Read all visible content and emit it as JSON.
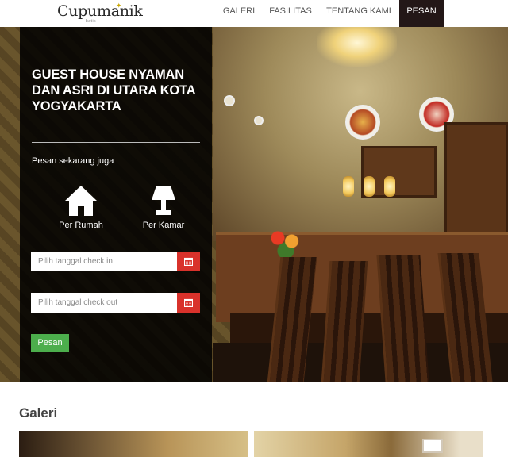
{
  "brand": {
    "name": "Cupumanik",
    "sub": "batik"
  },
  "nav": {
    "items": [
      {
        "label": "GALERI"
      },
      {
        "label": "FASILITAS"
      },
      {
        "label": "TENTANG KAMI"
      },
      {
        "label": "PESAN",
        "active": true
      }
    ]
  },
  "hero": {
    "title": "GUEST HOUSE NYAMAN DAN ASRI DI UTARA KOTA YOGYAKARTA",
    "booking_label": "Pesan sekarang juga",
    "options": [
      {
        "label": "Per Rumah",
        "icon": "house-icon"
      },
      {
        "label": "Per Kamar",
        "icon": "lamp-icon"
      }
    ],
    "checkin": {
      "placeholder": "Pilih tanggal check in",
      "value": ""
    },
    "checkout": {
      "placeholder": "Pilih tanggal check out",
      "value": ""
    },
    "submit_label": "Pesan"
  },
  "gallery": {
    "title": "Galeri"
  },
  "colors": {
    "nav_active_bg": "#231717",
    "calendar_button": "#d9322b",
    "submit_button": "#4cae4c",
    "panel_bg": "rgba(0,0,0,0.86)"
  }
}
